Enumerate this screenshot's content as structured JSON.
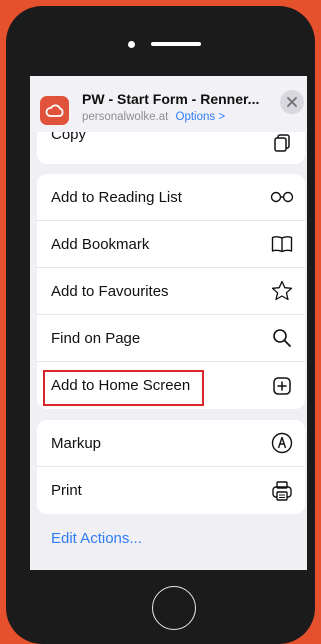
{
  "header": {
    "title": "PW - Start Form - Renner...",
    "domain": "personalwolke.at",
    "options_label": "Options",
    "options_chevron": ">"
  },
  "partial_row": {
    "label": "Copy",
    "icon": "copy-icon"
  },
  "group1": [
    {
      "label": "Add to Reading List",
      "icon": "reading-glasses-icon"
    },
    {
      "label": "Add Bookmark",
      "icon": "book-icon"
    },
    {
      "label": "Add to Favourites",
      "icon": "star-icon"
    },
    {
      "label": "Find on Page",
      "icon": "search-icon"
    },
    {
      "label": "Add to Home Screen",
      "icon": "plus-square-icon"
    }
  ],
  "group2": [
    {
      "label": "Markup",
      "icon": "markup-pen-icon"
    },
    {
      "label": "Print",
      "icon": "printer-icon"
    }
  ],
  "edit_actions": "Edit Actions...",
  "colors": {
    "background": "#e6512d",
    "accent": "#2f7cf6",
    "highlight": "#d8262a"
  }
}
